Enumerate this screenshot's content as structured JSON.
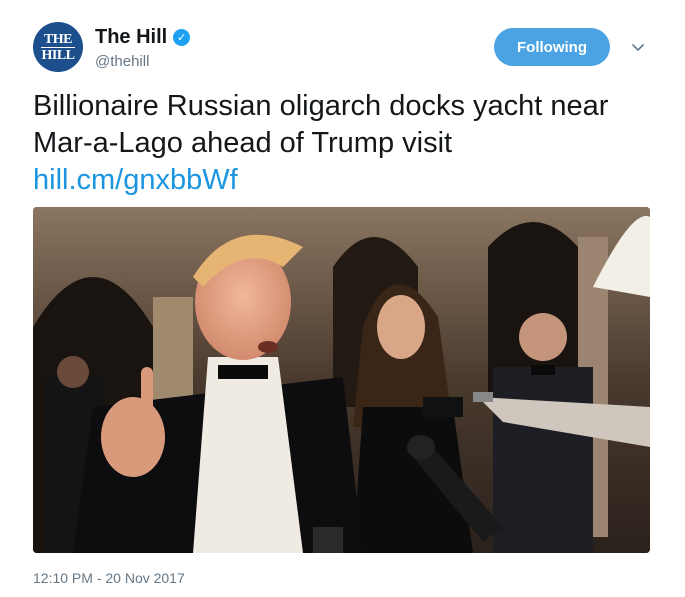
{
  "account": {
    "avatar_line1": "THE",
    "avatar_line2": "HILL",
    "display_name": "The Hill",
    "handle": "@thehill",
    "verified": true
  },
  "header": {
    "follow_label": "Following",
    "menu_icon": "chevron-down-icon"
  },
  "tweet": {
    "text": "Billionaire Russian oligarch docks yacht near Mar-a-Lago ahead of Trump visit",
    "link": "hill.cm/gnxbbWf"
  },
  "photo": {
    "description_icon": "photo"
  },
  "meta": {
    "timestamp": "12:10 PM - 20 Nov 2017"
  },
  "colors": {
    "accent": "#1da1f2",
    "link": "#1b95e0",
    "button": "#4ca3e3",
    "avatar": "#1c4f8c",
    "muted": "#657786"
  }
}
